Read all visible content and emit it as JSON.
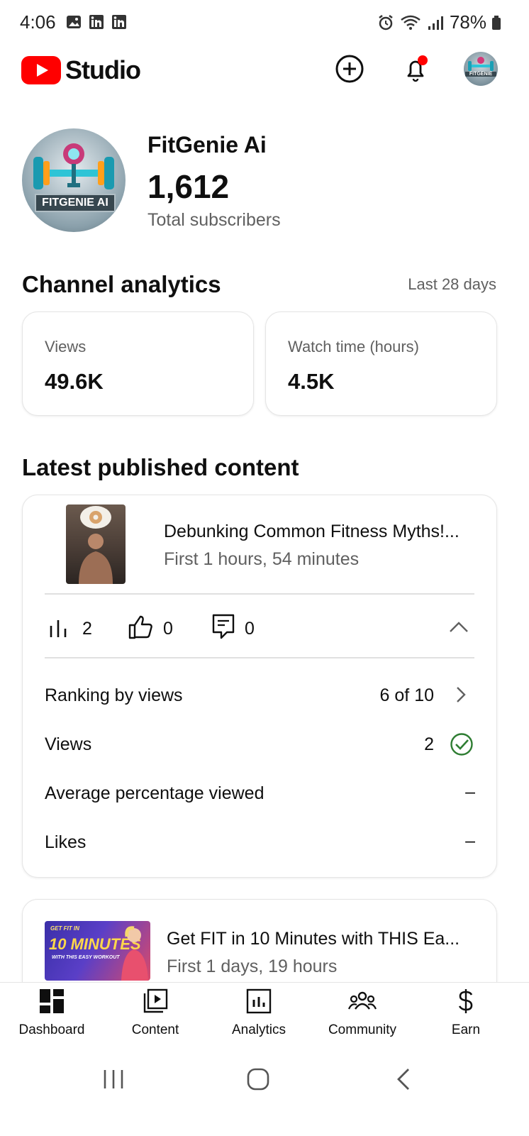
{
  "status_bar": {
    "time": "4:06",
    "battery": "78%"
  },
  "app_bar": {
    "logo_text": "Studio",
    "avatar_text": "FITGENIE"
  },
  "channel": {
    "name": "FitGenie Ai",
    "subscribers": "1,612",
    "subscribers_label": "Total subscribers",
    "avatar_text": "FITGENIE AI"
  },
  "analytics": {
    "title": "Channel analytics",
    "period": "Last 28 days",
    "metrics": [
      {
        "label": "Views",
        "value": "49.6K"
      },
      {
        "label": "Watch time (hours)",
        "value": "4.5K"
      }
    ]
  },
  "latest": {
    "title": "Latest published content",
    "video1": {
      "title": "Debunking Common Fitness Myths!...",
      "subtitle": "First 1 hours, 54 minutes",
      "views": "2",
      "likes": "0",
      "comments": "0",
      "rows": [
        {
          "label": "Ranking by views",
          "value": "6 of 10"
        },
        {
          "label": "Views",
          "value": "2"
        },
        {
          "label": "Average percentage viewed",
          "value": "–"
        },
        {
          "label": "Likes",
          "value": "–"
        }
      ]
    },
    "video2": {
      "title": "Get FIT in 10 Minutes with THIS Ea...",
      "subtitle": "First 1 days, 19 hours",
      "thumb_line1": "GET FIT IN",
      "thumb_line2": "10 MINUTES",
      "thumb_line3": "WITH THIS EASY WORKOUT"
    }
  },
  "bottom_nav": [
    "Dashboard",
    "Content",
    "Analytics",
    "Community",
    "Earn"
  ],
  "colors": {
    "brand_red": "#ff0000",
    "check_green": "#2e7d32",
    "text_secondary": "#606060"
  }
}
